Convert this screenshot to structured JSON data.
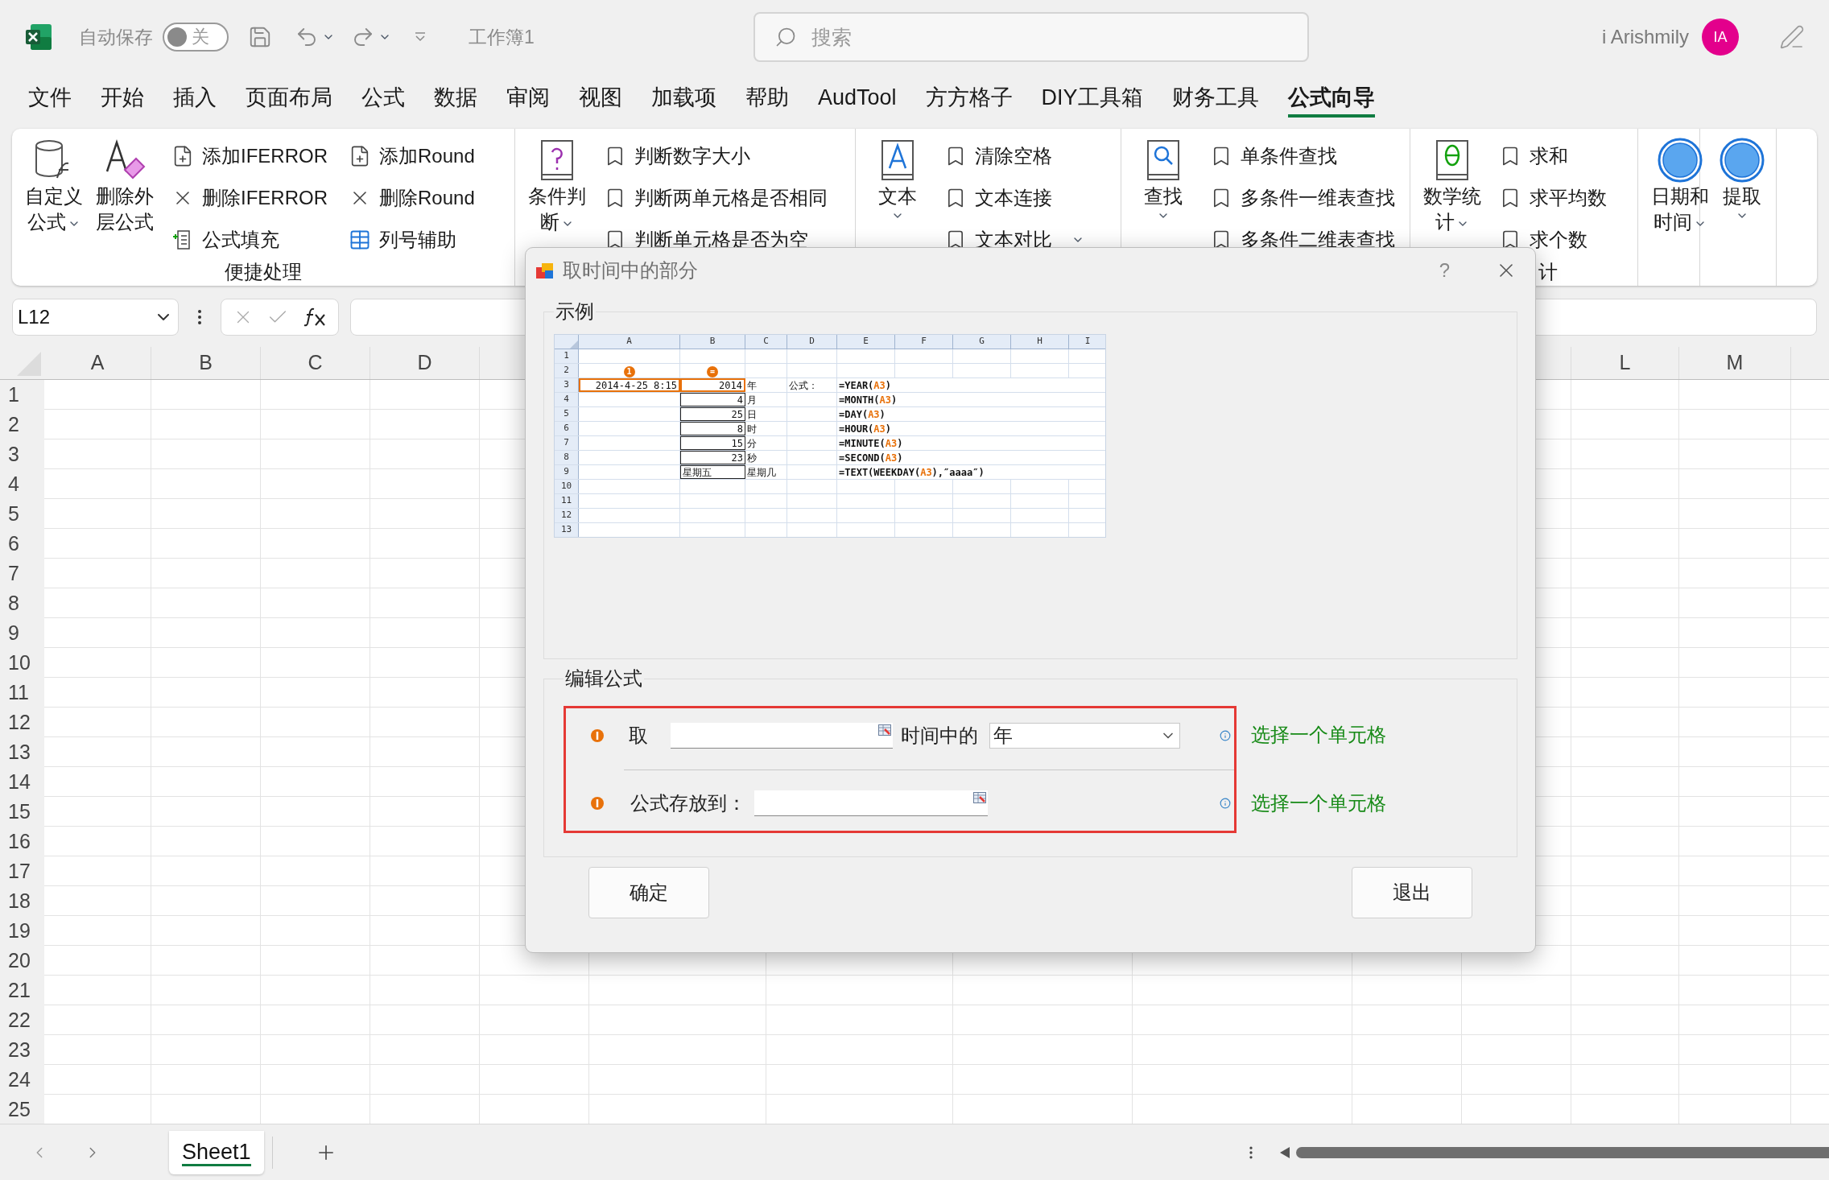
{
  "title_bar": {
    "autosave_label": "自动保存",
    "autosave": {
      "on": false,
      "label": "关"
    },
    "workbook": "工作簿1",
    "search": {
      "placeholder": "搜索"
    },
    "user": "i Arishmily",
    "avatar": "IA"
  },
  "menu_tabs": [
    {
      "label": "文件",
      "selected": false
    },
    {
      "label": "开始",
      "selected": false
    },
    {
      "label": "插入",
      "selected": false
    },
    {
      "label": "页面布局",
      "selected": false
    },
    {
      "label": "公式",
      "selected": false
    },
    {
      "label": "数据",
      "selected": false
    },
    {
      "label": "审阅",
      "selected": false
    },
    {
      "label": "视图",
      "selected": false
    },
    {
      "label": "加载项",
      "selected": false
    },
    {
      "label": "帮助",
      "selected": false
    },
    {
      "label": "AudTool",
      "selected": false
    },
    {
      "label": "方方格子",
      "selected": false
    },
    {
      "label": "DIY工具箱",
      "selected": false
    },
    {
      "label": "财务工具",
      "selected": false
    },
    {
      "label": "公式向导",
      "selected": true
    }
  ],
  "ribbon": {
    "groups": [
      {
        "label": "便捷处理",
        "large": [
          {
            "label": "自定义公式",
            "dropdown": true
          },
          {
            "label": "删除外层公式",
            "dropdown": false
          }
        ],
        "small": [
          {
            "label": "添加IFERROR",
            "dropdown": false
          },
          {
            "label": "删除IFERROR",
            "dropdown": false
          },
          {
            "label": "公式填充",
            "dropdown": false
          },
          {
            "label": "添加Round",
            "dropdown": false
          },
          {
            "label": "删除Round",
            "dropdown": false
          },
          {
            "label": "列号辅助",
            "dropdown": false
          }
        ]
      },
      {
        "large": [
          {
            "label": "条件判断",
            "dropdown": true
          }
        ],
        "small": [
          {
            "label": "判断数字大小",
            "dropdown": false
          },
          {
            "label": "判断两单元格是否相同",
            "dropdown": false
          },
          {
            "label": "判断单元格是否为空",
            "dropdown": false
          }
        ]
      },
      {
        "large": [
          {
            "label": "文本",
            "dropdown": true
          }
        ],
        "small": [
          {
            "label": "清除空格",
            "dropdown": false
          },
          {
            "label": "文本连接",
            "dropdown": false
          },
          {
            "label": "文本对比",
            "dropdown": true
          }
        ]
      },
      {
        "large": [
          {
            "label": "查找",
            "dropdown": true
          }
        ],
        "small": [
          {
            "label": "单条件查找",
            "dropdown": false
          },
          {
            "label": "多条件一维表查找",
            "dropdown": false
          },
          {
            "label": "多条件二维表查找",
            "dropdown": false
          }
        ]
      },
      {
        "label": "计",
        "large": [
          {
            "label": "数学统计",
            "dropdown": true
          }
        ],
        "small": [
          {
            "label": "求和",
            "dropdown": false
          },
          {
            "label": "求平均数",
            "dropdown": false
          },
          {
            "label": "求个数",
            "dropdown": false
          }
        ]
      },
      {
        "large": [
          {
            "label": "日期和时间",
            "dropdown": true
          }
        ]
      },
      {
        "large": [
          {
            "label": "提取",
            "dropdown": true
          }
        ]
      }
    ]
  },
  "formula_bar": {
    "name_box": "L12"
  },
  "sheet": {
    "columns_left": [
      "A",
      "B",
      "C",
      "D"
    ],
    "columns_right": [
      "L",
      "M"
    ],
    "rows": [
      "1",
      "2",
      "3",
      "4",
      "5",
      "6",
      "7",
      "8",
      "9",
      "10",
      "11",
      "12",
      "13",
      "14",
      "15",
      "16",
      "17",
      "18",
      "19",
      "20",
      "21",
      "22",
      "23",
      "24",
      "25"
    ]
  },
  "dialog": {
    "title": "取时间中的部分",
    "help": "?",
    "example": {
      "legend": "示例",
      "columns": [
        "A",
        "B",
        "C",
        "D",
        "E",
        "F",
        "G",
        "H",
        "I"
      ],
      "rows": [
        {
          "label": "1"
        },
        {
          "label": "2",
          "a": {
            "marker": "1"
          },
          "b": {
            "marker": "="
          }
        },
        {
          "label": "3",
          "a": {
            "text": "2014-4-25 8:15",
            "kind": "number",
            "highlighted": true
          },
          "b": {
            "text": "2014",
            "kind": "number",
            "highlighted": true,
            "bordered": true
          },
          "c": {
            "text": "年"
          },
          "d": {
            "text": "公式："
          },
          "e": {
            "formula": {
              "head": "=YEAR(",
              "ref": "A3",
              "tail": ")"
            }
          }
        },
        {
          "label": "4",
          "b": {
            "text": "4",
            "kind": "number",
            "bordered": true
          },
          "c": {
            "text": "月"
          },
          "e": {
            "formula": {
              "head": "=MONTH(",
              "ref": "A3",
              "tail": ")"
            }
          }
        },
        {
          "label": "5",
          "b": {
            "text": "25",
            "kind": "number",
            "bordered": true
          },
          "c": {
            "text": "日"
          },
          "e": {
            "formula": {
              "head": "=DAY(",
              "ref": "A3",
              "tail": ")"
            }
          }
        },
        {
          "label": "6",
          "b": {
            "text": "8",
            "kind": "number",
            "bordered": true
          },
          "c": {
            "text": "时"
          },
          "e": {
            "formula": {
              "head": "=HOUR(",
              "ref": "A3",
              "tail": ")"
            }
          }
        },
        {
          "label": "7",
          "b": {
            "text": "15",
            "kind": "number",
            "bordered": true
          },
          "c": {
            "text": "分"
          },
          "e": {
            "formula": {
              "head": "=MINUTE(",
              "ref": "A3",
              "tail": ")"
            }
          }
        },
        {
          "label": "8",
          "b": {
            "text": "23",
            "kind": "number",
            "bordered": true
          },
          "c": {
            "text": "秒"
          },
          "e": {
            "formula": {
              "head": "=SECOND(",
              "ref": "A3",
              "tail": ")"
            }
          }
        },
        {
          "label": "9",
          "b": {
            "text": "星期五",
            "kind": "text",
            "bordered": true
          },
          "c": {
            "text": "星期几"
          },
          "e": {
            "formula": {
              "head": "=TEXT(WEEKDAY(",
              "ref": "A3",
              "tail": "),″aaaa″)"
            }
          }
        },
        {
          "label": "10"
        },
        {
          "label": "11"
        },
        {
          "label": "12"
        },
        {
          "label": "13"
        }
      ]
    },
    "editor": {
      "legend": "编辑公式",
      "rows": [
        {
          "kind": "source",
          "label": "取",
          "between": "时间中的",
          "select": "年",
          "hint": "选择一个单元格"
        },
        {
          "kind": "target",
          "label": "公式存放到：",
          "hint": "选择一个单元格"
        }
      ]
    },
    "buttons": [
      "确定",
      "退出"
    ]
  },
  "sheet_tabs": [
    {
      "label": "Sheet1",
      "selected": true
    }
  ]
}
